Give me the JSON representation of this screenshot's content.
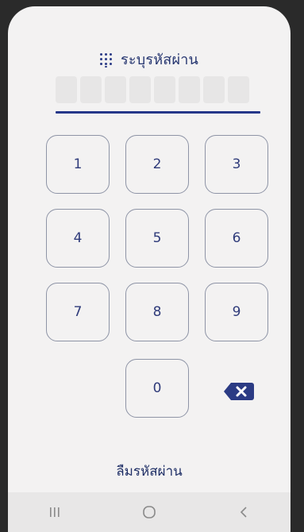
{
  "header": {
    "icon": "keypad-grid-icon",
    "title": "ระบุรหัสผ่าน"
  },
  "pin": {
    "length": 8,
    "entered": 0
  },
  "keypad": {
    "keys": [
      "1",
      "2",
      "3",
      "4",
      "5",
      "6",
      "7",
      "8",
      "9",
      "0"
    ],
    "backspace_icon": "backspace-icon"
  },
  "footer": {
    "forgot_label": "ลืมรหัสผ่าน"
  },
  "navbar": {
    "recents_icon": "recent-apps-icon",
    "home_icon": "home-icon",
    "back_icon": "back-icon"
  },
  "colors": {
    "accent": "#25378a",
    "text": "#2f3b7a",
    "key_border": "#8e94a6",
    "backspace_bg": "#2b3b84"
  }
}
